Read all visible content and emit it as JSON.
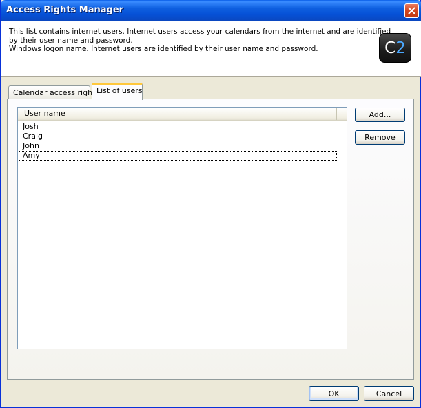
{
  "window": {
    "title": "Access Rights Manager"
  },
  "header": {
    "description_lines": [
      "This list contains internet users. Internet users access your calendars from the internet and are identified",
      "by their user name and password.",
      "Windows logon name. Internet users are identified by their user name and password."
    ],
    "logo_text_c": "C",
    "logo_text_2": "2"
  },
  "tabs": [
    {
      "label": "Calendar access rights",
      "selected": false
    },
    {
      "label": "List of users",
      "selected": true
    }
  ],
  "user_list": {
    "column_header": "User name",
    "rows": [
      "Josh",
      "Craig",
      "John",
      "Amy"
    ],
    "focused_index": 3
  },
  "buttons": {
    "add": "Add...",
    "remove": "Remove",
    "ok": "OK",
    "cancel": "Cancel"
  },
  "colors": {
    "titlebar": "#0651d6",
    "window_bg": "#ece9d8",
    "tab_highlight": "#ffc83c"
  }
}
